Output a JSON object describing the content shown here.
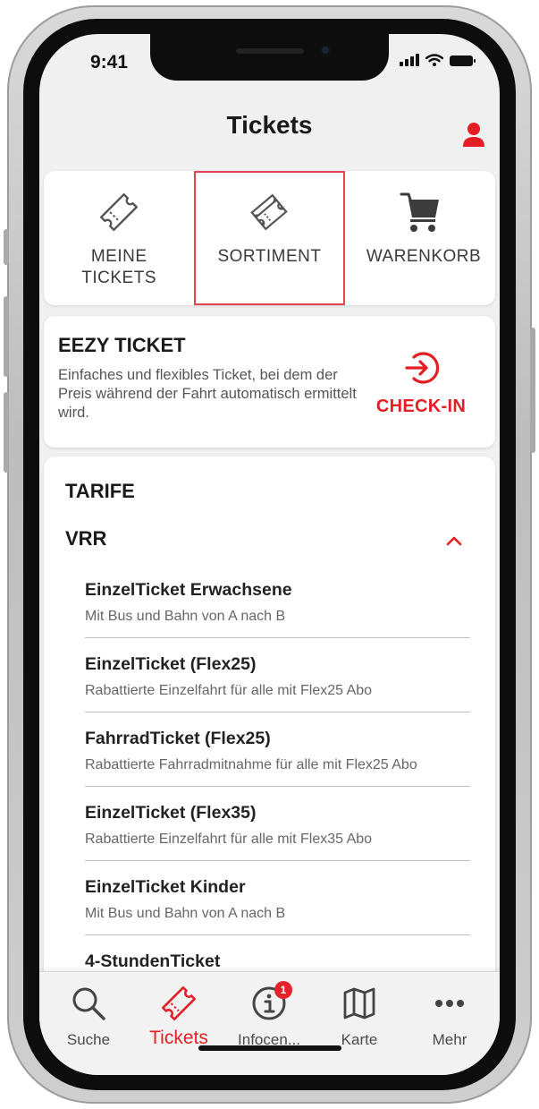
{
  "status": {
    "time": "9:41"
  },
  "header": {
    "title": "Tickets"
  },
  "tabs": [
    {
      "label": "MEINE TICKETS",
      "icon": "ticket-icon",
      "selected": false
    },
    {
      "label": "SORTIMENT",
      "icon": "tickets-stack-icon",
      "selected": true
    },
    {
      "label": "WARENKORB",
      "icon": "cart-icon",
      "selected": false
    }
  ],
  "eezy": {
    "title": "EEZY TICKET",
    "description": "Einfaches und flexibles Ticket, bei dem der Preis während der Fahrt automatisch ermittelt wird.",
    "checkin_label": "CHECK-IN"
  },
  "tarife": {
    "title": "TARIFE",
    "group": "VRR",
    "items": [
      {
        "name": "EinzelTicket Erwachsene",
        "desc": "Mit Bus und Bahn von A nach B"
      },
      {
        "name": "EinzelTicket (Flex25)",
        "desc": "Rabattierte Einzelfahrt für alle mit Flex25 Abo"
      },
      {
        "name": "FahrradTicket (Flex25)",
        "desc": "Rabattierte Fahrradmitnahme für alle mit Flex25 Abo"
      },
      {
        "name": "EinzelTicket (Flex35)",
        "desc": "Rabattierte Einzelfahrt für alle mit Flex35 Abo"
      },
      {
        "name": "EinzelTicket Kinder",
        "desc": "Mit Bus und Bahn von A nach B"
      },
      {
        "name": "4-StundenTicket",
        "desc": ""
      }
    ]
  },
  "nav": [
    {
      "label": "Suche",
      "icon": "search-icon"
    },
    {
      "label": "Tickets",
      "icon": "ticket-icon",
      "active": true
    },
    {
      "label": "Infocen...",
      "icon": "info-icon",
      "badge": "1"
    },
    {
      "label": "Karte",
      "icon": "map-icon"
    },
    {
      "label": "Mehr",
      "icon": "more-icon"
    }
  ],
  "colors": {
    "accent": "#e31e24",
    "background": "#f0f0f0",
    "card": "#ffffff"
  }
}
